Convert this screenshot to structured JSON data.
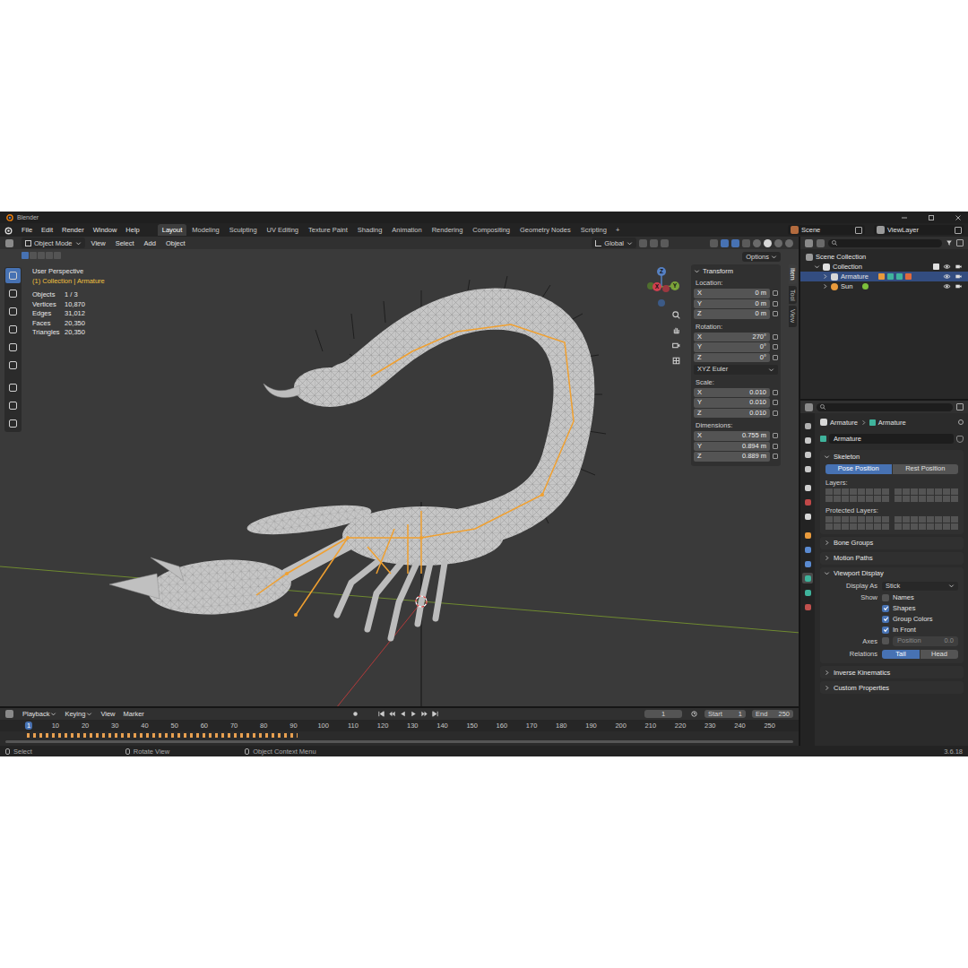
{
  "window": {
    "title": "Blender"
  },
  "menu": [
    "File",
    "Edit",
    "Render",
    "Window",
    "Help"
  ],
  "workspaces": [
    {
      "label": "Layout",
      "selected": true
    },
    {
      "label": "Modeling",
      "selected": false
    },
    {
      "label": "Sculpting",
      "selected": false
    },
    {
      "label": "UV Editing",
      "selected": false
    },
    {
      "label": "Texture Paint",
      "selected": false
    },
    {
      "label": "Shading",
      "selected": false
    },
    {
      "label": "Animation",
      "selected": false
    },
    {
      "label": "Rendering",
      "selected": false
    },
    {
      "label": "Compositing",
      "selected": false
    },
    {
      "label": "Geometry Nodes",
      "selected": false
    },
    {
      "label": "Scripting",
      "selected": false
    }
  ],
  "add_workspace": "+",
  "scene": "Scene",
  "view_layer": "ViewLayer",
  "viewport": {
    "mode": "Object Mode",
    "menus": [
      "View",
      "Select",
      "Add",
      "Object"
    ],
    "orientation": "Global",
    "options": "Options",
    "overlay_title": "User Perspective",
    "overlay_context": "(1) Collection | Armature",
    "stats": [
      {
        "label": "Objects",
        "value": "1 / 3"
      },
      {
        "label": "Vertices",
        "value": "10,870"
      },
      {
        "label": "Edges",
        "value": "31,012"
      },
      {
        "label": "Faces",
        "value": "20,350"
      },
      {
        "label": "Triangles",
        "value": "20,350"
      }
    ],
    "tools": [
      {
        "selected": true
      },
      {
        "selected": false
      },
      {
        "selected": false
      },
      {
        "selected": false
      },
      {
        "selected": false
      },
      {
        "selected": false
      },
      {
        "selected": false
      },
      {
        "selected": false
      },
      {
        "selected": false
      }
    ],
    "gizmo": {
      "x": "X",
      "y": "Y",
      "z": "Z"
    }
  },
  "sidebar": {
    "tabs": [
      {
        "label": "Item",
        "selected": true
      },
      {
        "label": "Tool",
        "selected": false
      },
      {
        "label": "View",
        "selected": false
      }
    ],
    "panel": "Transform",
    "groups": [
      {
        "label": "Location:",
        "fields": [
          {
            "axis": "X",
            "value": "0 m"
          },
          {
            "axis": "Y",
            "value": "0 m"
          },
          {
            "axis": "Z",
            "value": "0 m"
          }
        ]
      },
      {
        "label": "Rotation:",
        "fields": [
          {
            "axis": "X",
            "value": "270°"
          },
          {
            "axis": "Y",
            "value": "0°"
          },
          {
            "axis": "Z",
            "value": "0°"
          }
        ],
        "mode": "XYZ Euler"
      },
      {
        "label": "Scale:",
        "fields": [
          {
            "axis": "X",
            "value": "0.010"
          },
          {
            "axis": "Y",
            "value": "0.010"
          },
          {
            "axis": "Z",
            "value": "0.010"
          }
        ]
      },
      {
        "label": "Dimensions:",
        "fields": [
          {
            "axis": "X",
            "value": "0.755 m"
          },
          {
            "axis": "Y",
            "value": "0.894 m"
          },
          {
            "axis": "Z",
            "value": "0.889 m"
          }
        ]
      }
    ]
  },
  "outliner": {
    "items": [
      {
        "label": "Scene Collection",
        "kind": "scene",
        "depth": 0,
        "expanded": true,
        "selected": false
      },
      {
        "label": "Collection",
        "kind": "collection",
        "depth": 1,
        "expanded": true,
        "selected": false
      },
      {
        "label": "Armature",
        "kind": "object",
        "depth": 2,
        "expanded": false,
        "selected": true
      },
      {
        "label": "Sun",
        "kind": "object",
        "depth": 2,
        "expanded": false,
        "selected": false
      }
    ]
  },
  "properties": {
    "tabs": [
      {
        "color": "#b0b0b0",
        "selected": false
      },
      {
        "color": "#c8c8c8",
        "selected": false
      },
      {
        "color": "#c8c8c8",
        "selected": false
      },
      {
        "color": "#c8c8c8",
        "selected": false
      },
      {
        "color": "#d0d0d0",
        "selected": false
      },
      {
        "color": "#c04848",
        "selected": false
      },
      {
        "color": "#d8d8d8",
        "selected": false
      },
      {
        "color": "#e89a3c",
        "selected": false
      },
      {
        "color": "#5a8ad0",
        "selected": false
      },
      {
        "color": "#5a8ad0",
        "selected": false
      },
      {
        "color": "#3fb39c",
        "selected": true
      },
      {
        "color": "#3fb39c",
        "selected": false
      },
      {
        "color": "#c0504d",
        "selected": false
      }
    ],
    "breadcrumb": [
      "Armature",
      "Armature"
    ],
    "name": "Armature",
    "skeleton": {
      "title": "Skeleton",
      "expanded": true,
      "positions": [
        {
          "label": "Pose Position",
          "selected": true
        },
        {
          "label": "Rest Position",
          "selected": false
        }
      ],
      "layers_label": "Layers:",
      "protected_label": "Protected Layers:"
    },
    "collapsed": [
      {
        "title": "Bone Groups",
        "expanded": false
      },
      {
        "title": "Motion Paths",
        "expanded": false
      }
    ],
    "viewport_display": {
      "title": "Viewport Display",
      "expanded": true,
      "display_as_label": "Display As",
      "display_as": "Stick",
      "show_label": "Show",
      "show": [
        {
          "label": "Names",
          "checked": false
        },
        {
          "label": "Shapes",
          "checked": true
        },
        {
          "label": "Group Colors",
          "checked": true
        },
        {
          "label": "In Front",
          "checked": true
        }
      ],
      "axes": {
        "label": "Axes",
        "checked": false,
        "position_label": "Position",
        "position": "0.0"
      },
      "relations": {
        "label": "Relations",
        "options": [
          {
            "label": "Tail",
            "selected": true
          },
          {
            "label": "Head",
            "selected": false
          }
        ]
      }
    },
    "more": [
      {
        "title": "Inverse Kinematics",
        "expanded": false
      },
      {
        "title": "Custom Properties",
        "expanded": false
      }
    ]
  },
  "timeline": {
    "menus": [
      "Playback",
      "Keying",
      "View",
      "Marker"
    ],
    "current_frame": "1",
    "start_label": "Start",
    "start": "1",
    "end_label": "End",
    "end": "250",
    "ticks": [
      "1",
      "10",
      "20",
      "30",
      "40",
      "50",
      "60",
      "70",
      "80",
      "90",
      "100",
      "110",
      "120",
      "130",
      "140",
      "150",
      "160",
      "170",
      "180",
      "190",
      "200",
      "210",
      "220",
      "230",
      "240",
      "250"
    ]
  },
  "status_bar": {
    "items": [
      "Select",
      "Rotate View",
      "Object Context Menu"
    ],
    "version": "3.6.18"
  }
}
